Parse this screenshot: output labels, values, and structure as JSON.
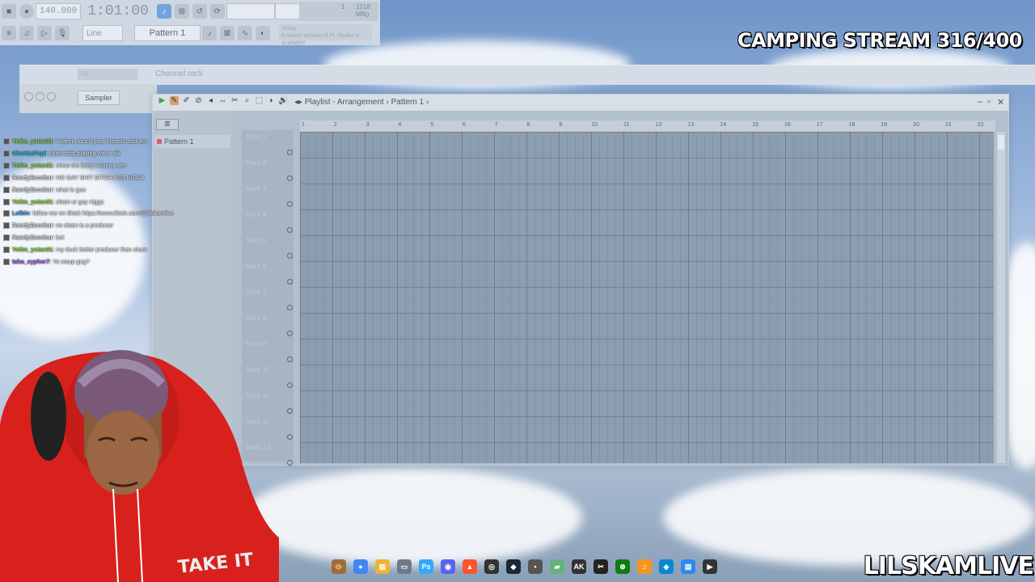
{
  "toolbar": {
    "tempo": "140.000",
    "time": "1:01:00",
    "mode": "Line",
    "pattern": "Pattern 1",
    "cpu_value": "1",
    "memory": "1518 MB",
    "poly": "0",
    "update_notice_title": "Today",
    "update_notice": "A newer version of FL Studio is available!"
  },
  "channel_rack": {
    "title": "Channel rack",
    "filter": "All",
    "channel": "Sampler"
  },
  "playlist": {
    "crumb_1": "Playlist",
    "crumb_sep": "-",
    "crumb_2": "Arrangement",
    "crumb_3": "Pattern 1",
    "pattern_item": "Pattern 1",
    "ruler": [
      "1",
      "2",
      "3",
      "4",
      "5",
      "6",
      "7",
      "8",
      "9",
      "10",
      "11",
      "12",
      "13",
      "14",
      "15",
      "16",
      "17",
      "18",
      "19",
      "20",
      "21",
      "22"
    ],
    "tracks": [
      "Track 1",
      "Track 2",
      "Track 3",
      "Track 4",
      "Track 5",
      "Track 6",
      "Track 7",
      "Track 8",
      "Track 9",
      "Track 10",
      "Track 11",
      "Track 12",
      "Track 13"
    ]
  },
  "chat": [
    {
      "user": "Yetim_yutan31",
      "msg": ": i wanna touch your breasts and ass",
      "color": "#9be14d"
    },
    {
      "user": "ChorizoPapi",
      "msg": ": skam stop playing wit ur dik",
      "color": "#3fc6d8"
    },
    {
      "user": "Yetim_yutan31",
      "msg": ": show me baby i wanna see",
      "color": "#9be14d"
    },
    {
      "user": "RandyEscobar",
      "msg": ": NO GAY SHIT BITCH ASS NICCA",
      "color": "#e8e8e8"
    },
    {
      "user": "RandyEscobar",
      "msg": ": what is guu",
      "color": "#e8e8e8"
    },
    {
      "user": "Yetim_yutan31",
      "msg": ": skam ur gay nigga",
      "color": "#9be14d"
    },
    {
      "user": "Lolbin",
      "msg": ": follow me on tiktok https://www.tiktok.com/@lilskamlive",
      "color": "#4aa6ff"
    },
    {
      "user": "RandyEscobar",
      "msg": ": no skam is a producer",
      "color": "#e8e8e8"
    },
    {
      "user": "RandyEscobar",
      "msg": ": bet",
      "color": "#e8e8e8"
    },
    {
      "user": "Yetim_yutan31",
      "msg": ": my duck better producer than skam",
      "color": "#9be14d"
    },
    {
      "user": "taha_cypher7",
      "msg": ": Yo waup gng?",
      "color": "#b06cff"
    }
  ],
  "overlay": {
    "stream_title": "CAMPING STREAM 316/400",
    "streamer": "LILSKAMLIVE",
    "hoodie_text": "TAKE IT"
  },
  "taskbar_icons": [
    "monkey-app-icon",
    "chrome-icon",
    "file-explorer-icon",
    "notepad-icon",
    "photoshop-icon",
    "discord-icon",
    "brave-icon",
    "obs-icon",
    "steam-icon",
    "app-icon",
    "minecraft-icon",
    "ak-icon",
    "capcut-icon",
    "xbox-icon",
    "fl-studio-icon",
    "edge-icon",
    "notepad2-icon",
    "media-player-icon"
  ]
}
